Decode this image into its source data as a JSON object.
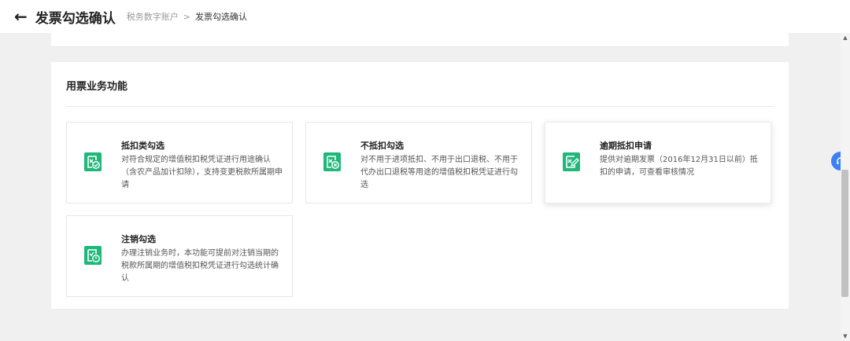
{
  "header": {
    "back_icon": "arrow-left-icon",
    "title": "发票勾选确认",
    "breadcrumb": {
      "parent": "税务数字账户",
      "separator": ">",
      "current": "发票勾选确认"
    }
  },
  "section": {
    "title": "用票业务功能"
  },
  "cards": [
    {
      "title": "抵扣类勾选",
      "desc": "对符合规定的增值税扣税凭证进行用途确认（含农产品加计扣除），支持变更税款所属期申请",
      "icon": "invoice-check-icon"
    },
    {
      "title": "不抵扣勾选",
      "desc": "对不用于进项抵扣、不用于出口退税、不用于代办出口退税等用途的增值税扣税凭证进行勾选",
      "icon": "invoice-cross-icon"
    },
    {
      "title": "逾期抵扣申请",
      "desc": "提供对逾期发票（2016年12月31日以前）抵扣的申请，可查看审核情况",
      "icon": "invoice-edit-icon"
    },
    {
      "title": "注销勾选",
      "desc": "办理注销业务时，本功能可提前对注销当期的税款所属期的增值税扣税凭证进行勾选统计确认",
      "icon": "invoice-power-icon"
    }
  ],
  "colors": {
    "icon_green": "#1fb87a",
    "accent_blue": "#3d7ff6"
  },
  "floating": {
    "icon": "headset-icon"
  },
  "scrollbar": {
    "up_arrow": "▲",
    "down_arrow": "▼"
  }
}
